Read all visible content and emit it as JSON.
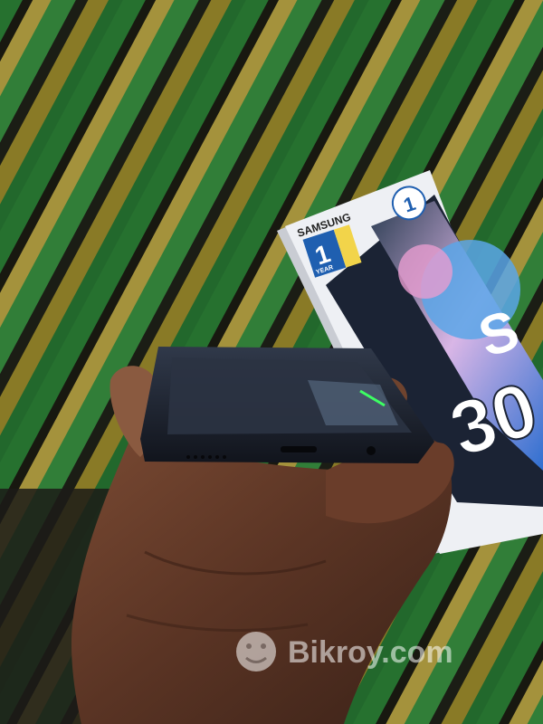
{
  "photo": {
    "box_brand": "SAMSUNG",
    "box_model_fragment": "30",
    "box_model_prefix": "S",
    "warranty_badge_year": "1",
    "warranty_badge_text": "YEAR",
    "corner_badge_number": "1",
    "watermark": "Bikroy.com"
  },
  "colors": {
    "stripe_green": "#2f8a3a",
    "stripe_olive": "#b9a23a",
    "stripe_dark": "#1e1e14",
    "box_white": "#eef0f4",
    "phone_dark": "#1b1f2a",
    "skin": "#5a3424",
    "accent_blue": "#1f5fb0"
  }
}
